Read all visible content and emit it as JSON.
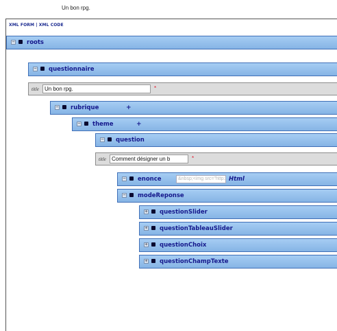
{
  "page": {
    "title": "Un bon rpg."
  },
  "tabs": {
    "xml_form": "XML FORM",
    "separator": " | ",
    "xml_code": "XML CODE"
  },
  "nodes": {
    "roots": {
      "label": "roots"
    },
    "questionnaire": {
      "label": "questionnaire",
      "attr_label": "title",
      "attr_value": "Un bon rpg.",
      "required": "*"
    },
    "rubrique": {
      "label": "rubrique",
      "add": "+"
    },
    "theme": {
      "label": "theme",
      "add": "+"
    },
    "question": {
      "label": "question",
      "attr_label": "title",
      "attr_value": "Comment désigner un b",
      "required": "*"
    },
    "enonce": {
      "label": "enonce",
      "value": "&nbsp;<img src=\"http://v",
      "type_label": "Html"
    },
    "modeReponse": {
      "label": "modeReponse"
    },
    "questionSlider": {
      "label": "questionSlider"
    },
    "questionTableauSlider": {
      "label": "questionTableauSlider"
    },
    "questionChoix": {
      "label": "questionChoix"
    },
    "questionChampTexte": {
      "label": "questionChampTexte"
    }
  },
  "toggle_symbols": {
    "expanded": "−",
    "collapsed": "+"
  },
  "colors": {
    "node_bg": "#97c1ec",
    "node_text": "#15188c",
    "attr_bg": "#dcdcdc",
    "required": "#e2142a"
  }
}
